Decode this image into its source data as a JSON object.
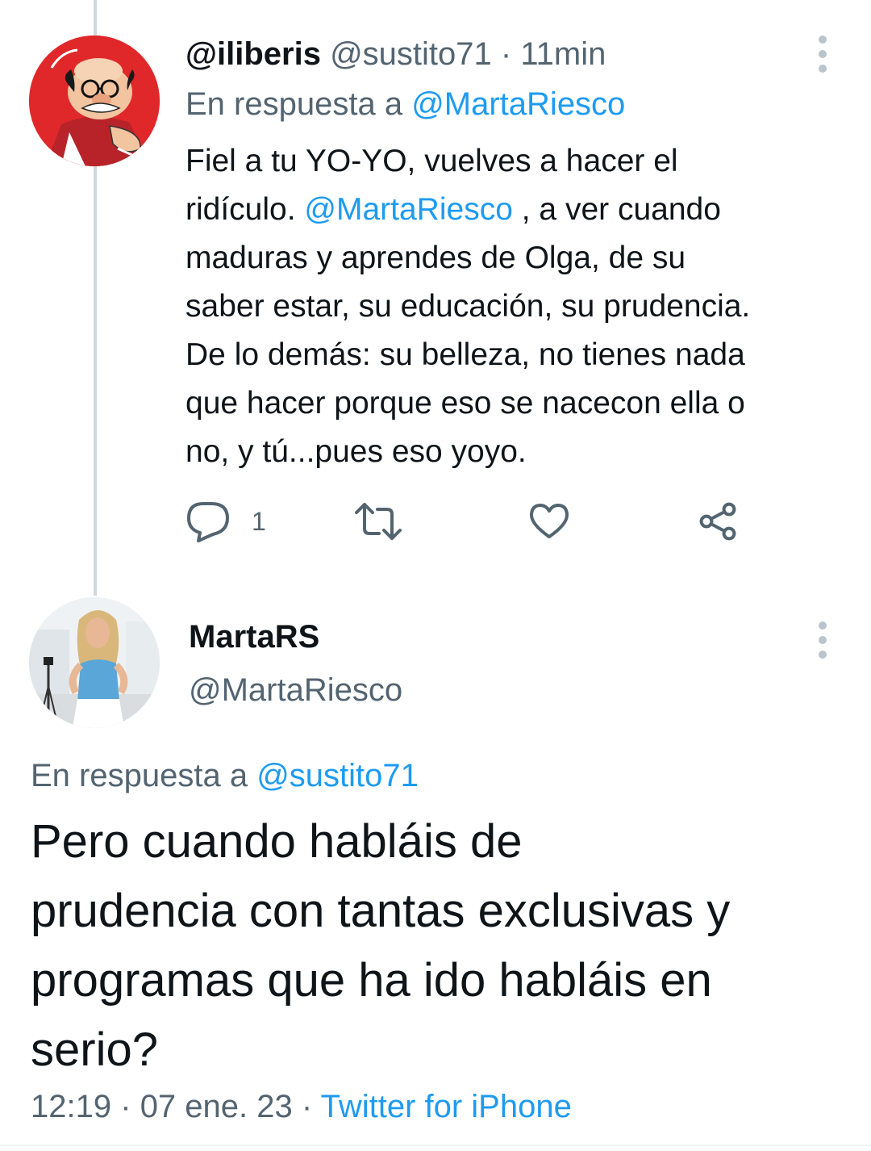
{
  "tweet1": {
    "display_name": "@iliberis",
    "handle": "@sustito71",
    "separator": "·",
    "time": "11min",
    "reply_prefix": "En respuesta a",
    "reply_to": "@MartaRiesco",
    "body_lines": [
      "Fiel a tu YO-YO, vuelves a hacer el",
      "ridículo.",
      "@MartaRiesco",
      ", a ver cuando",
      "maduras y aprendes de Olga, de su",
      "saber estar, su educación, su prudencia.",
      "De lo demás: su belleza, no tienes nada",
      "que hacer porque eso se nacecon ella o",
      "no, y tú...pues eso yoyo."
    ],
    "reply_count": "1",
    "icons": {
      "reply": "reply-icon",
      "retweet": "retweet-icon",
      "like": "heart-icon",
      "share": "share-icon",
      "more": "more-icon",
      "avatar": "avatar-cartoon"
    }
  },
  "tweet2": {
    "display_name": "MartaRS",
    "handle": "@MartaRiesco",
    "reply_prefix": "En respuesta a",
    "reply_to": "@sustito71",
    "body_lines": [
      "Pero cuando habláis de",
      "prudencia con tantas exclusivas y",
      "programas que ha ido habláis en",
      "serio?"
    ],
    "time": "12:19",
    "separator1": "·",
    "date": "07 ene. 23",
    "separator2": "·",
    "source": "Twitter for iPhone"
  },
  "colors": {
    "text": "#0f1419",
    "secondary": "#536471",
    "link": "#1d9bf0",
    "thread_line": "#cfd9de",
    "icon": "#536471"
  }
}
